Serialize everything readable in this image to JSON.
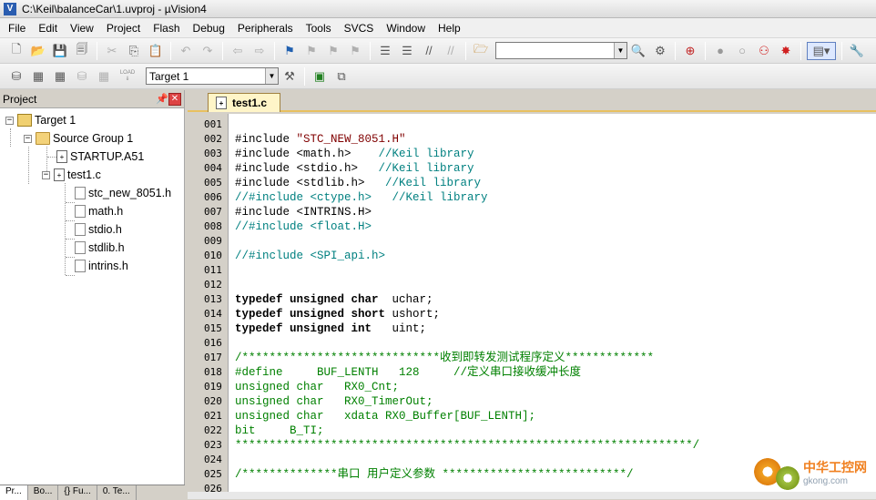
{
  "window": {
    "title": "C:\\Keil\\balanceCar\\1.uvproj - µVision4"
  },
  "menu": [
    "File",
    "Edit",
    "View",
    "Project",
    "Flash",
    "Debug",
    "Peripherals",
    "Tools",
    "SVCS",
    "Window",
    "Help"
  ],
  "toolbar2": {
    "target_value": "Target 1",
    "load_label": "LOAD"
  },
  "project_panel": {
    "title": "Project",
    "tree": [
      {
        "label": "Target 1"
      },
      {
        "label": "Source Group 1"
      },
      {
        "label": "STARTUP.A51"
      },
      {
        "label": "test1.c"
      },
      {
        "label": "stc_new_8051.h"
      },
      {
        "label": "math.h"
      },
      {
        "label": "stdio.h"
      },
      {
        "label": "stdlib.h"
      },
      {
        "label": "intrins.h"
      }
    ],
    "bottom_tabs": [
      "Pr...",
      "Bo...",
      "{} Fu...",
      "0. Te..."
    ]
  },
  "editor": {
    "tab": "test1.c",
    "lines": [
      {
        "n": "001",
        "segs": []
      },
      {
        "n": "002",
        "segs": [
          {
            "c": "",
            "t": "#include "
          },
          {
            "c": "st",
            "t": "\"STC_NEW_8051.H\""
          }
        ]
      },
      {
        "n": "003",
        "segs": [
          {
            "c": "",
            "t": "#include <math.h>    "
          },
          {
            "c": "cm",
            "t": "//Keil library"
          }
        ]
      },
      {
        "n": "004",
        "segs": [
          {
            "c": "",
            "t": "#include <stdio.h>   "
          },
          {
            "c": "cm",
            "t": "//Keil library"
          }
        ]
      },
      {
        "n": "005",
        "segs": [
          {
            "c": "",
            "t": "#include <stdlib.h>   "
          },
          {
            "c": "cm",
            "t": "//Keil library"
          }
        ]
      },
      {
        "n": "006",
        "segs": [
          {
            "c": "cm",
            "t": "//#include <ctype.h>   //Keil library"
          }
        ]
      },
      {
        "n": "007",
        "segs": [
          {
            "c": "",
            "t": "#include <INTRINS.H>"
          }
        ]
      },
      {
        "n": "008",
        "segs": [
          {
            "c": "cm",
            "t": "//#include <float.H>"
          }
        ]
      },
      {
        "n": "009",
        "segs": []
      },
      {
        "n": "010",
        "segs": [
          {
            "c": "cm",
            "t": "//#include <SPI_api.h>"
          }
        ]
      },
      {
        "n": "011",
        "segs": []
      },
      {
        "n": "012",
        "segs": []
      },
      {
        "n": "013",
        "segs": [
          {
            "c": "kw",
            "t": "typedef unsigned char"
          },
          {
            "c": "",
            "t": "  uchar;"
          }
        ]
      },
      {
        "n": "014",
        "segs": [
          {
            "c": "kw",
            "t": "typedef unsigned short"
          },
          {
            "c": "",
            "t": " ushort;"
          }
        ]
      },
      {
        "n": "015",
        "segs": [
          {
            "c": "kw",
            "t": "typedef unsigned int"
          },
          {
            "c": "",
            "t": "   uint;"
          }
        ]
      },
      {
        "n": "016",
        "segs": []
      },
      {
        "n": "017",
        "segs": [
          {
            "c": "grn",
            "t": "/*****************************收到即转发测试程序定义*************"
          }
        ]
      },
      {
        "n": "018",
        "segs": [
          {
            "c": "grn",
            "t": "#define     BUF_LENTH   128     //定义串口接收缓冲长度"
          }
        ]
      },
      {
        "n": "019",
        "segs": [
          {
            "c": "grn",
            "t": "unsigned char   RX0_Cnt;"
          }
        ]
      },
      {
        "n": "020",
        "segs": [
          {
            "c": "grn",
            "t": "unsigned char   RX0_TimerOut;"
          }
        ]
      },
      {
        "n": "021",
        "segs": [
          {
            "c": "grn",
            "t": "unsigned char   xdata RX0_Buffer[BUF_LENTH];"
          }
        ]
      },
      {
        "n": "022",
        "segs": [
          {
            "c": "grn",
            "t": "bit     B_TI;"
          }
        ]
      },
      {
        "n": "023",
        "segs": [
          {
            "c": "grn",
            "t": "*******************************************************************/"
          }
        ]
      },
      {
        "n": "024",
        "segs": []
      },
      {
        "n": "025",
        "segs": [
          {
            "c": "grn",
            "t": "/**************串口 用户定义参数 ***************************/"
          }
        ]
      },
      {
        "n": "026",
        "segs": []
      }
    ]
  },
  "watermark": {
    "cn": "中华工控网",
    "en": "gkong.com"
  }
}
